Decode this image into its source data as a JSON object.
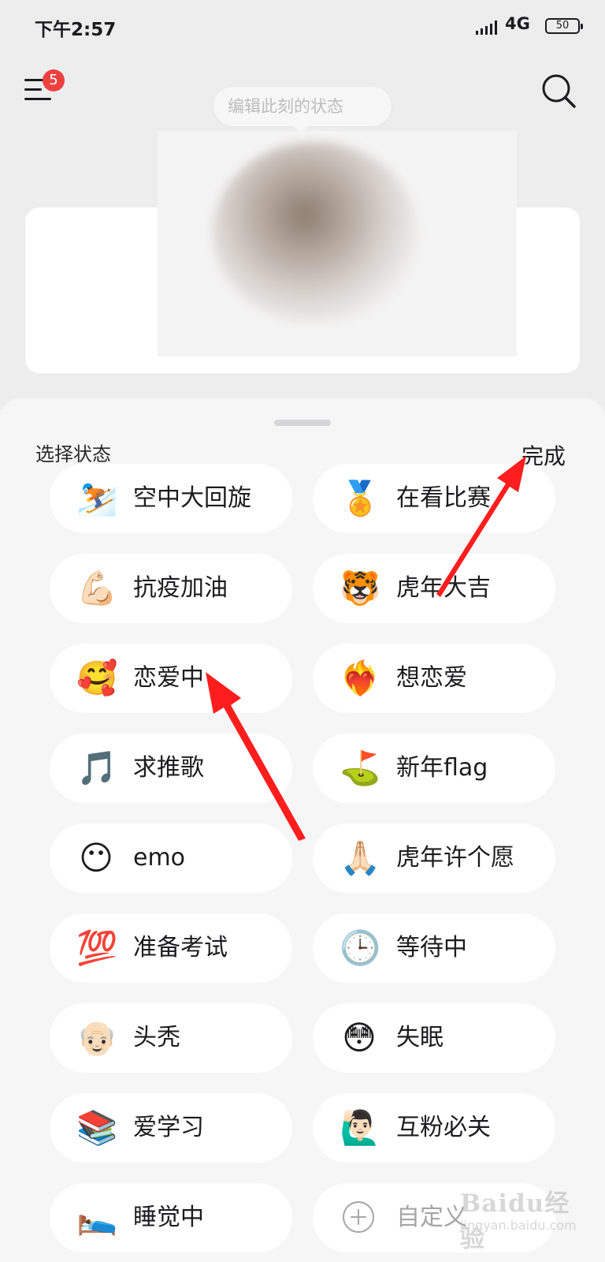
{
  "status_bar": {
    "time": "下午2:57",
    "network": "4G",
    "battery": "50"
  },
  "header": {
    "menu_badge": "5",
    "status_input_placeholder": "编辑此刻的状态"
  },
  "sheet": {
    "title": "选择状态",
    "done_label": "完成",
    "status_options": [
      {
        "emoji": "⛷️",
        "icon": "skier-icon",
        "label": "空中大回旋"
      },
      {
        "emoji": "🏅",
        "icon": "medal-icon",
        "label": "在看比赛"
      },
      {
        "emoji": "💪🏻",
        "icon": "flexed-biceps-icon",
        "label": "抗疫加油"
      },
      {
        "emoji": "🐯",
        "icon": "tiger-face-icon",
        "label": "虎年大吉"
      },
      {
        "emoji": "🥰",
        "icon": "smiling-face-with-hearts-icon",
        "label": "恋爱中"
      },
      {
        "emoji": "❤️‍🔥",
        "icon": "heart-on-fire-icon",
        "label": "想恋爱"
      },
      {
        "emoji": "🎵",
        "icon": "music-note-icon",
        "label": "求推歌"
      },
      {
        "emoji": "⛳",
        "icon": "flag-in-hole-icon",
        "label": "新年flag"
      },
      {
        "emoji": "😶",
        "icon": "face-without-mouth-icon",
        "label": "emo"
      },
      {
        "emoji": "🙏🏻",
        "icon": "folded-hands-icon",
        "label": "虎年许个愿"
      },
      {
        "emoji": "💯",
        "icon": "hundred-points-icon",
        "label": "准备考试"
      },
      {
        "emoji": "🕒",
        "icon": "clock-icon",
        "label": "等待中"
      },
      {
        "emoji": "👴🏻",
        "icon": "old-man-icon",
        "label": "头秃"
      },
      {
        "emoji": "😳",
        "icon": "flushed-face-icon",
        "label": "失眠"
      },
      {
        "emoji": "📚",
        "icon": "books-icon",
        "label": "爱学习"
      },
      {
        "emoji": "🙋🏻‍♂️",
        "icon": "man-raising-hand-icon",
        "label": "互粉必关"
      },
      {
        "emoji": "🛌",
        "icon": "person-in-bed-icon",
        "label": "睡觉中"
      },
      {
        "emoji": "",
        "icon": "plus-circle-icon",
        "label": "自定义"
      }
    ]
  },
  "watermark": {
    "main": "Baidu经验",
    "sub": "jingyan.baidu.com"
  },
  "colors": {
    "arrow": "#ff1d1d",
    "badge": "#ef4040",
    "chip_background": "#ffffff"
  }
}
